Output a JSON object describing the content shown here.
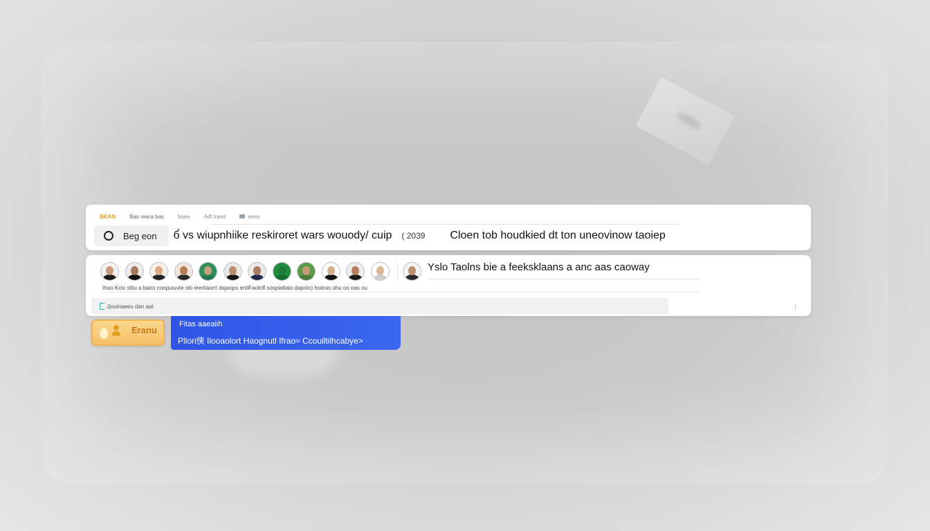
{
  "header_tabs": [
    {
      "label": "BKAN"
    },
    {
      "label": "Bas  reera  bas"
    },
    {
      "label": "bsee"
    },
    {
      "label": "Adt  toeet"
    },
    {
      "label": "eese"
    }
  ],
  "search": {
    "scope": "Beg eon",
    "query": "б́ vs wiupnhiike  reskiroret wars  wouody/ cuip",
    "year": "( 2039",
    "hint": "Cloen tob houdkied dt ton uneovinow taoiep"
  },
  "people": {
    "title": "Yslo  Taolns bie  a  feeksklaans  a  anc aas caoway",
    "names_line": "Ihao Kcio sltiu  a  bairo coopuiuvte olo ieertiaorrl dajaops  entiFaolofl sospialtaio dapolo)  hoiiras ohu oo  oas ou",
    "avatars": [
      {
        "name": "avatar",
        "skin": "#c99a7a",
        "shirt": "#1a1a1a",
        "bg": "#f2f2f2"
      },
      {
        "name": "avatar",
        "skin": "#a5785c",
        "shirt": "#111111",
        "bg": "#ececec"
      },
      {
        "name": "avatar",
        "skin": "#d8aa86",
        "shirt": "#222222",
        "bg": "#f4efe9"
      },
      {
        "name": "avatar",
        "skin": "#b97e58",
        "shirt": "#2b2b2b",
        "bg": "#f0e6dc"
      },
      {
        "name": "avatar",
        "skin": "#c8a07e",
        "shirt": "#1f7a4f",
        "bg": "#2f8f5a"
      },
      {
        "name": "avatar",
        "skin": "#bb8d6c",
        "shirt": "#141414",
        "bg": "#e9e9e9"
      },
      {
        "name": "avatar",
        "skin": "#a87b62",
        "shirt": "#1e2a48",
        "bg": "#eaeaea"
      },
      {
        "name": "avatar",
        "skin": "#1f7a3a",
        "shirt": "#156c2e",
        "bg": "#1e8e3e"
      },
      {
        "name": "avatar",
        "skin": "#c69a74",
        "shirt": "#4a7d3a",
        "bg": "#5a9a4a"
      },
      {
        "name": "avatar",
        "skin": "#d4b08c",
        "shirt": "#111111",
        "bg": "#ffffff"
      },
      {
        "name": "avatar",
        "skin": "#b67f5d",
        "shirt": "#1a1a1a",
        "bg": "#efefef"
      },
      {
        "name": "avatar",
        "skin": "#d9b796",
        "shirt": "#cfcfcf",
        "bg": "#ffffff"
      },
      {
        "name": "avatar",
        "skin": "#c09070",
        "shirt": "#2a2a2a",
        "bg": "#f3f3f3"
      }
    ]
  },
  "footer": {
    "text": "Jjooinaeeu dan aat"
  },
  "more_menu": "⋮",
  "orange_chip": {
    "label": "Eranu",
    "color": "#f6c16a"
  },
  "blue_card": {
    "line1": "Fitas aaeaiih",
    "line2": "Pllori侠 Ilooaolort  Haognutl Ifrao≈ Ccouiltilhcabye>",
    "color": "#2f55e6"
  }
}
